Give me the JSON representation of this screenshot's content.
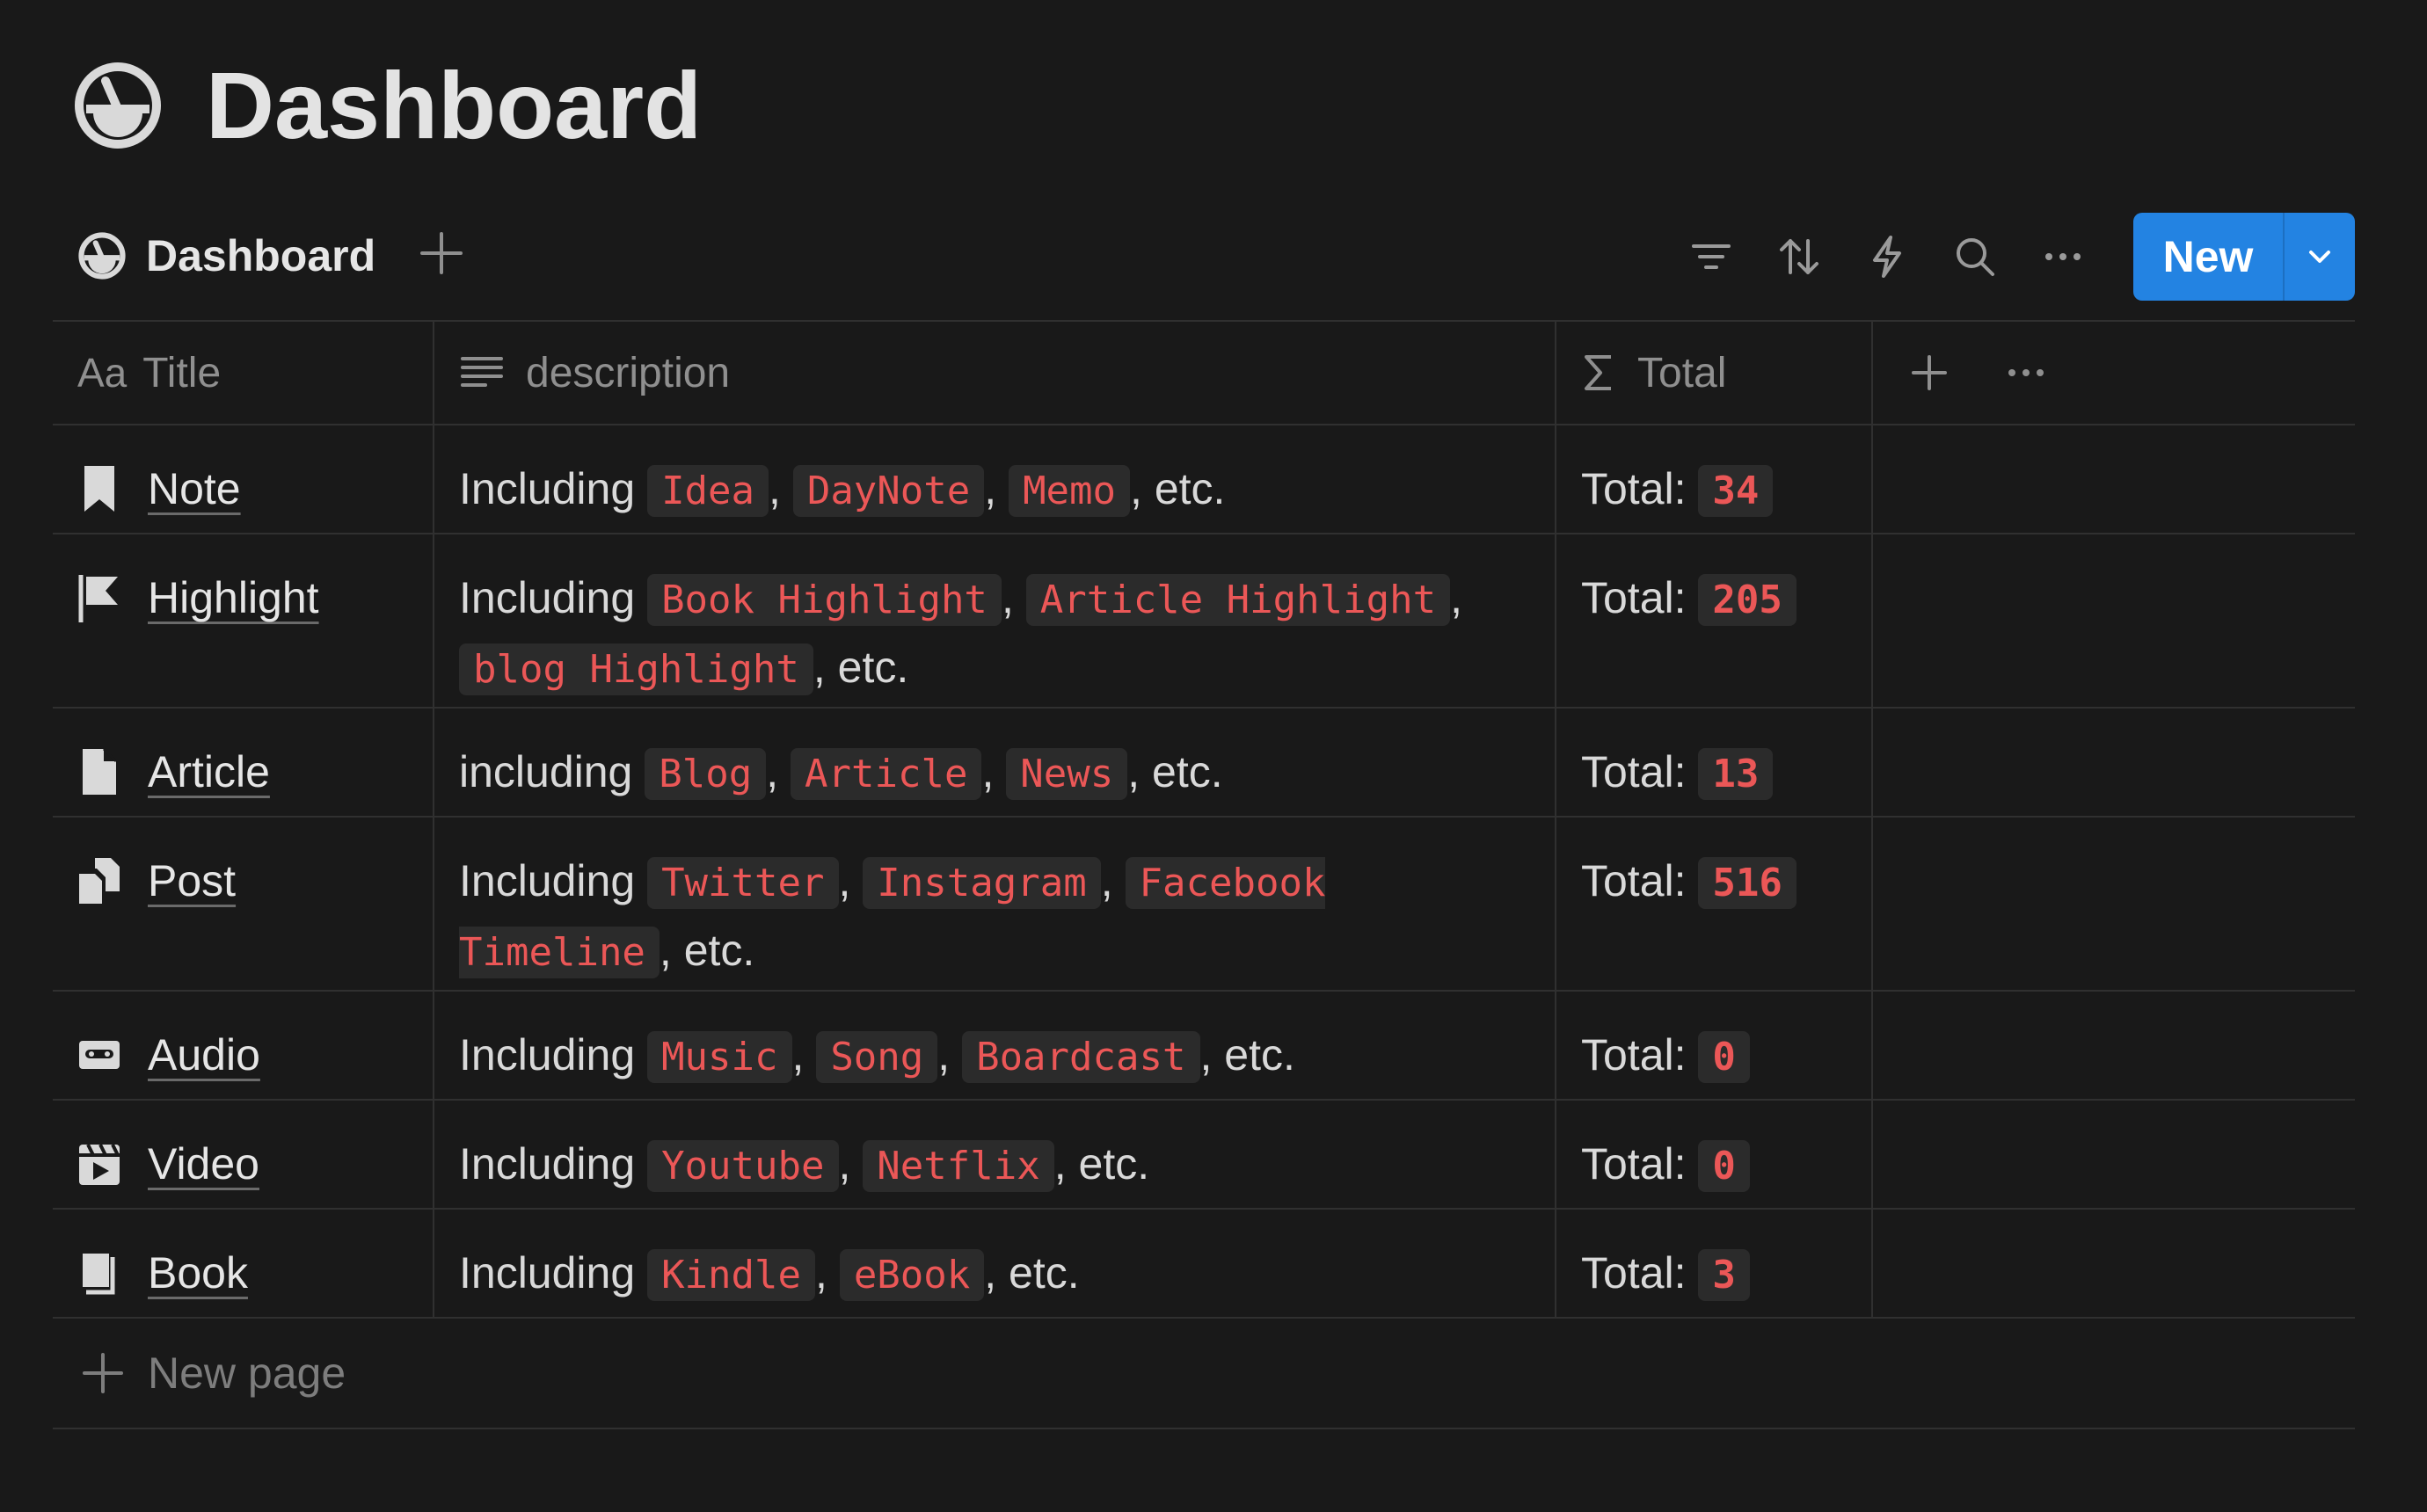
{
  "page": {
    "title": "Dashboard"
  },
  "view": {
    "tab_label": "Dashboard",
    "new_button_label": "New"
  },
  "columns": {
    "title": {
      "prefix": "Aa",
      "label": "Title"
    },
    "description": {
      "label": "description"
    },
    "total": {
      "label": "Total"
    }
  },
  "rows": [
    {
      "icon": "bookmark-icon",
      "title": "Note",
      "lead": "Including",
      "tags": [
        "Idea",
        "DayNote",
        "Memo"
      ],
      "tail": ", etc.",
      "total_label": "Total:",
      "total": "34"
    },
    {
      "icon": "flag-icon",
      "title": "Highlight",
      "lead": "Including",
      "tags": [
        "Book Highlight",
        "Article Highlight",
        "blog Highlight"
      ],
      "tail": ", etc.",
      "total_label": "Total:",
      "total": "205"
    },
    {
      "icon": "document-icon",
      "title": "Article",
      "lead": "including",
      "tags": [
        "Blog",
        "Article",
        "News"
      ],
      "tail": ", etc.",
      "total_label": "Total:",
      "total": "13"
    },
    {
      "icon": "documents-icon",
      "title": "Post",
      "lead": "Including",
      "tags": [
        "Twitter",
        "Instagram",
        "Facebook Timeline"
      ],
      "tail": ", etc.",
      "total_label": "Total:",
      "total": "516"
    },
    {
      "icon": "cassette-icon",
      "title": "Audio",
      "lead": "Including",
      "tags": [
        "Music",
        "Song",
        "Boardcast"
      ],
      "tail": ", etc.",
      "total_label": "Total:",
      "total": "0"
    },
    {
      "icon": "clapperboard-icon",
      "title": "Video",
      "lead": "Including",
      "tags": [
        "Youtube",
        "Netflix"
      ],
      "tail": ", etc.",
      "total_label": "Total:",
      "total": "0"
    },
    {
      "icon": "book-icon",
      "title": "Book",
      "lead": "Including",
      "tags": [
        "Kindle",
        "eBook"
      ],
      "tail": ", etc.",
      "total_label": "Total:",
      "total": "3"
    }
  ],
  "footer": {
    "new_page_label": "New page"
  },
  "colors": {
    "accent": "#2383e2",
    "tag_text": "#eb5757",
    "tag_bg": "#2b2b2b",
    "background": "#191919"
  }
}
